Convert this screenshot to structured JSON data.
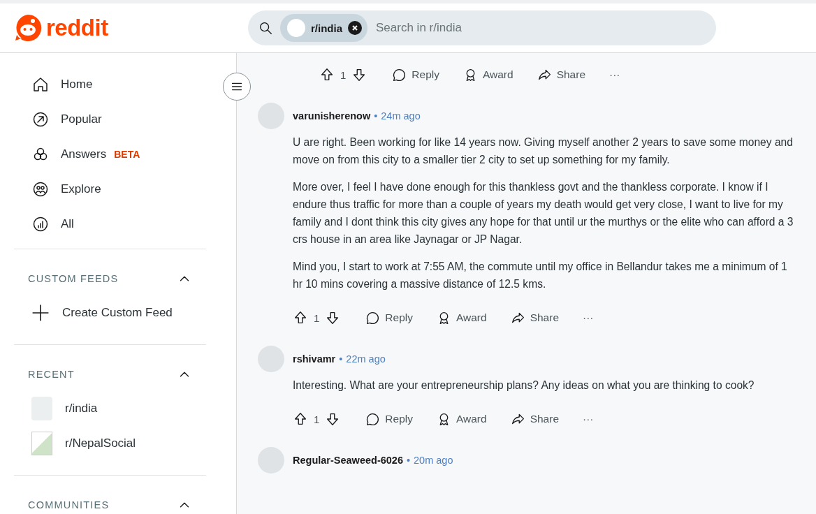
{
  "header": {
    "logo_text": "reddit",
    "search": {
      "chip": "r/india",
      "placeholder": "Search in r/india"
    }
  },
  "sidebar": {
    "nav": [
      {
        "label": "Home"
      },
      {
        "label": "Popular"
      },
      {
        "label": "Answers",
        "badge": "BETA"
      },
      {
        "label": "Explore"
      },
      {
        "label": "All"
      }
    ],
    "sections": [
      {
        "title": "CUSTOM FEEDS",
        "expanded": true,
        "items": [
          {
            "kind": "add",
            "label": "Create Custom Feed"
          }
        ]
      },
      {
        "title": "RECENT",
        "expanded": true,
        "items": [
          {
            "kind": "community",
            "label": "r/india"
          },
          {
            "kind": "broken",
            "label": "r/NepalSocial"
          }
        ]
      },
      {
        "title": "COMMUNITIES",
        "expanded": true
      }
    ]
  },
  "top_actions": {
    "score": "1",
    "reply": "Reply",
    "award": "Award",
    "share": "Share",
    "more": "···"
  },
  "comments": [
    {
      "author": "varunisherenow",
      "separator": "•",
      "time": "24m ago",
      "paragraphs": [
        "U are right. Been working for like 14 years now. Giving myself another 2 years to save some money and move on from this city to a smaller tier 2 city to set up something for my family.",
        "More over, I feel I have done enough for this thankless govt and the thankless corporate. I know if I endure thus traffic for more than a couple of years my death would get very close, I want to live for my family and I dont think this city gives any hope for that until ur the murthys or the elite who can afford a 3 crs house in an area like Jaynagar or JP Nagar.",
        "Mind you, I start to work at 7:55 AM, the commute until my office in Bellandur takes me a minimum of 1 hr 10 mins covering a massive distance of 12.5 kms."
      ],
      "actions": {
        "score": "1",
        "reply": "Reply",
        "award": "Award",
        "share": "Share",
        "more": "···"
      }
    },
    {
      "author": "rshivamr",
      "separator": "•",
      "time": "22m ago",
      "paragraphs": [
        "Interesting. What are your entrepreneurship plans? Any ideas on what you are thinking to cook?"
      ],
      "actions": {
        "score": "1",
        "reply": "Reply",
        "award": "Award",
        "share": "Share",
        "more": "···"
      }
    },
    {
      "author": "Regular-Seaweed-6026",
      "separator": "•",
      "time": "20m ago"
    }
  ]
}
